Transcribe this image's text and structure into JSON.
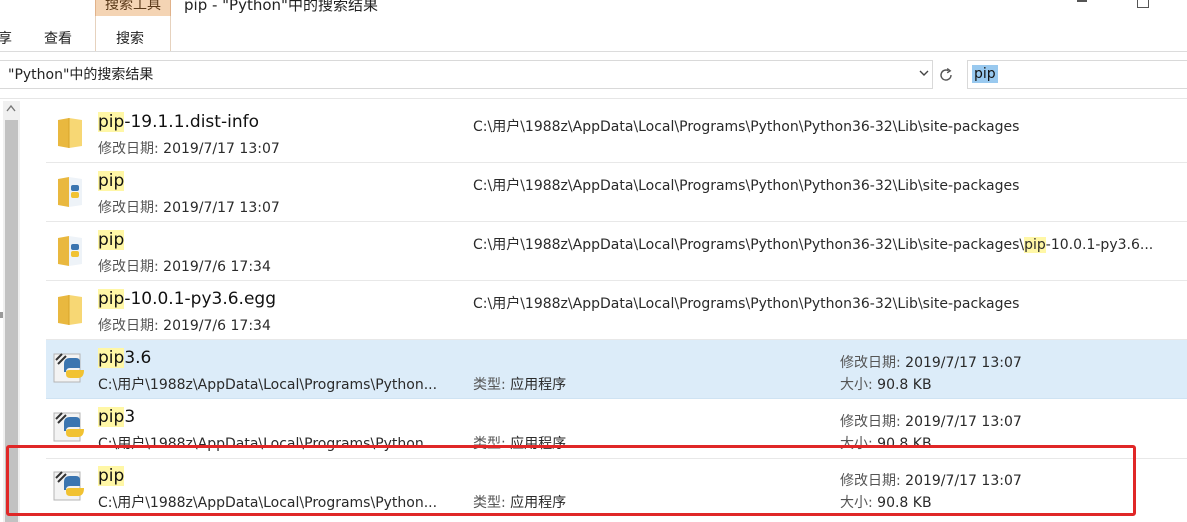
{
  "window": {
    "title": "pip - \"Python\"中的搜索结果"
  },
  "ribbon": {
    "context_tab_label": "搜索工具",
    "tabs": [
      "享",
      "查看",
      "搜索"
    ]
  },
  "address": {
    "breadcrumb": "\"Python\"中的搜索结果"
  },
  "search": {
    "query": "pip"
  },
  "results": [
    {
      "name_hl": "pip",
      "name_rest": "-19.1.1.dist-info",
      "icon": "folder-icon",
      "meta_label": "修改日期:",
      "meta_value": "2019/7/17 13:07",
      "path_before": "C:\\用户\\1988z\\AppData\\Local\\Programs\\Python\\Python36-32\\Lib\\site-packages",
      "path_hl": "",
      "path_after": ""
    },
    {
      "name_hl": "pip",
      "name_rest": "",
      "icon": "python-package-folder-icon",
      "meta_label": "修改日期:",
      "meta_value": "2019/7/17 13:07",
      "path_before": "C:\\用户\\1988z\\AppData\\Local\\Programs\\Python\\Python36-32\\Lib\\site-packages",
      "path_hl": "",
      "path_after": ""
    },
    {
      "name_hl": "pip",
      "name_rest": "",
      "icon": "python-package-folder-icon",
      "meta_label": "修改日期:",
      "meta_value": "2019/7/6 17:34",
      "path_before": "C:\\用户\\1988z\\AppData\\Local\\Programs\\Python\\Python36-32\\Lib\\site-packages\\",
      "path_hl": "pip",
      "path_after": "-10.0.1-py3.6..."
    },
    {
      "name_hl": "pip",
      "name_rest": "-10.0.1-py3.6.egg",
      "icon": "folder-icon",
      "meta_label": "修改日期:",
      "meta_value": "2019/7/6 17:34",
      "path_before": "C:\\用户\\1988z\\AppData\\Local\\Programs\\Python\\Python36-32\\Lib\\site-packages",
      "path_hl": "",
      "path_after": ""
    },
    {
      "name_hl": "pip",
      "name_rest": "3.6",
      "icon": "python-executable-icon",
      "path": "C:\\用户\\1988z\\AppData\\Local\\Programs\\Python...",
      "type_label": "类型:",
      "type_value": "应用程序",
      "date_label": "修改日期:",
      "date_value": "2019/7/17 13:07",
      "size_label": "大小:",
      "size_value": "90.8 KB"
    },
    {
      "name_hl": "pip",
      "name_rest": "3",
      "icon": "python-executable-icon",
      "path": "C:\\用户\\1988z\\AppData\\Local\\Programs\\Python...",
      "type_label": "类型:",
      "type_value": "应用程序",
      "date_label": "修改日期:",
      "date_value": "2019/7/17 13:07",
      "size_label": "大小:",
      "size_value": "90.8 KB"
    },
    {
      "name_hl": "pip",
      "name_rest": "",
      "icon": "python-executable-icon",
      "path": "C:\\用户\\1988z\\AppData\\Local\\Programs\\Python...",
      "type_label": "类型:",
      "type_value": "应用程序",
      "date_label": "修改日期:",
      "date_value": "2019/7/17 13:07",
      "size_label": "大小:",
      "size_value": "90.8 KB"
    }
  ],
  "colors": {
    "selection": "#dcecf9",
    "highlight": "#fff7a6",
    "annotation": "#e02727",
    "search_selection": "#99c9ef"
  }
}
